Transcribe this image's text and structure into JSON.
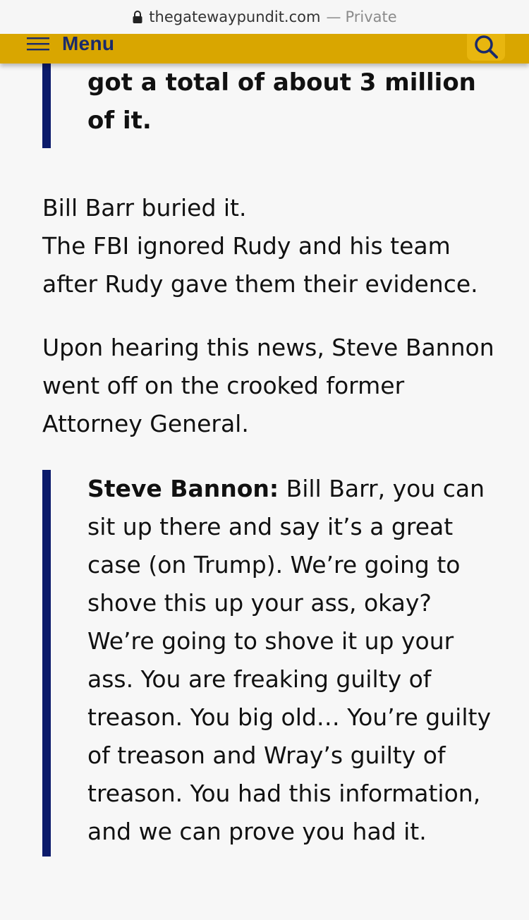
{
  "browser": {
    "url": "thegatewaypundit.com",
    "separator": "—",
    "mode": "Private",
    "lock_icon": "lock-icon"
  },
  "nav": {
    "menu_label": "Menu",
    "menu_icon": "hamburger-icon",
    "search_icon": "search-icon",
    "bar_color": "#d9a600",
    "text_color": "#1a2a6b"
  },
  "article": {
    "top_quote": "got a total of about 3 million of it.",
    "paragraphs": [
      [
        "Bill Barr buried it.",
        "The FBI ignored Rudy and his team after Rudy gave them their evidence."
      ],
      [
        "Upon hearing this news, Steve Bannon went off on the crooked former Attorney General."
      ]
    ],
    "quote": {
      "speaker": "Steve Bannon:",
      "text": "Bill Barr, you can sit up there and say it’s a great case (on Trump). We’re going to shove this up your ass, okay? We’re going to shove it up your ass. You are freaking guilty of treason. You big old… You’re guilty of treason and Wray’s guilty of treason. You had this information, and we can prove you had it.",
      "border_color": "#0c1b6b"
    }
  }
}
